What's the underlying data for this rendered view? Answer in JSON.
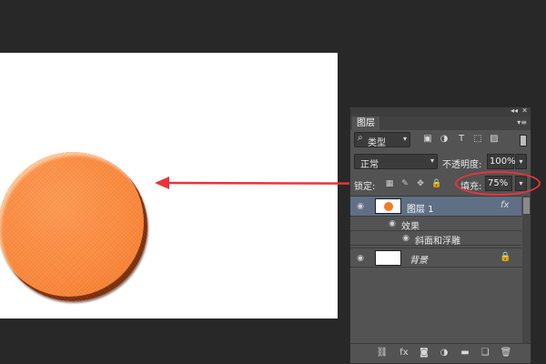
{
  "panel": {
    "tab_label": "图层",
    "collapse_glyph": "◂◂",
    "close_glyph": "✕",
    "menu_glyph": "▾≡",
    "filter": {
      "kind_label": "类型",
      "search_glyph": "⌕",
      "arrow_glyph": "▾",
      "icons": [
        "▣",
        "◑",
        "T",
        "⬚",
        "▨"
      ]
    },
    "blend": {
      "mode": "正常",
      "arrow_glyph": "▾",
      "opacity_label": "不透明度:",
      "opacity_value": "100%"
    },
    "lock": {
      "label": "锁定:",
      "icons": [
        "▦",
        "✎",
        "✥",
        "🔒"
      ],
      "fill_label": "填充:",
      "fill_value": "75%"
    },
    "layers": [
      {
        "name": "图层 1",
        "fx": "fx",
        "visible_glyph": "◉"
      },
      {
        "name": "背景",
        "lock_glyph": "🔒",
        "visible_glyph": "◉"
      }
    ],
    "effects": {
      "group_label": "效果",
      "bevel_label": "斜面和浮雕",
      "eye_glyph": "◉"
    },
    "bottom_icons": [
      "⛓",
      "fx",
      "◙",
      "◑",
      "▬",
      "❏",
      "🗑"
    ]
  },
  "colors": {
    "workspace": "#282828",
    "panel": "#535353",
    "selected_layer": "#5f6f86",
    "accent_annotation": "#e8343b",
    "shape_fill": "#fb8a3d"
  }
}
